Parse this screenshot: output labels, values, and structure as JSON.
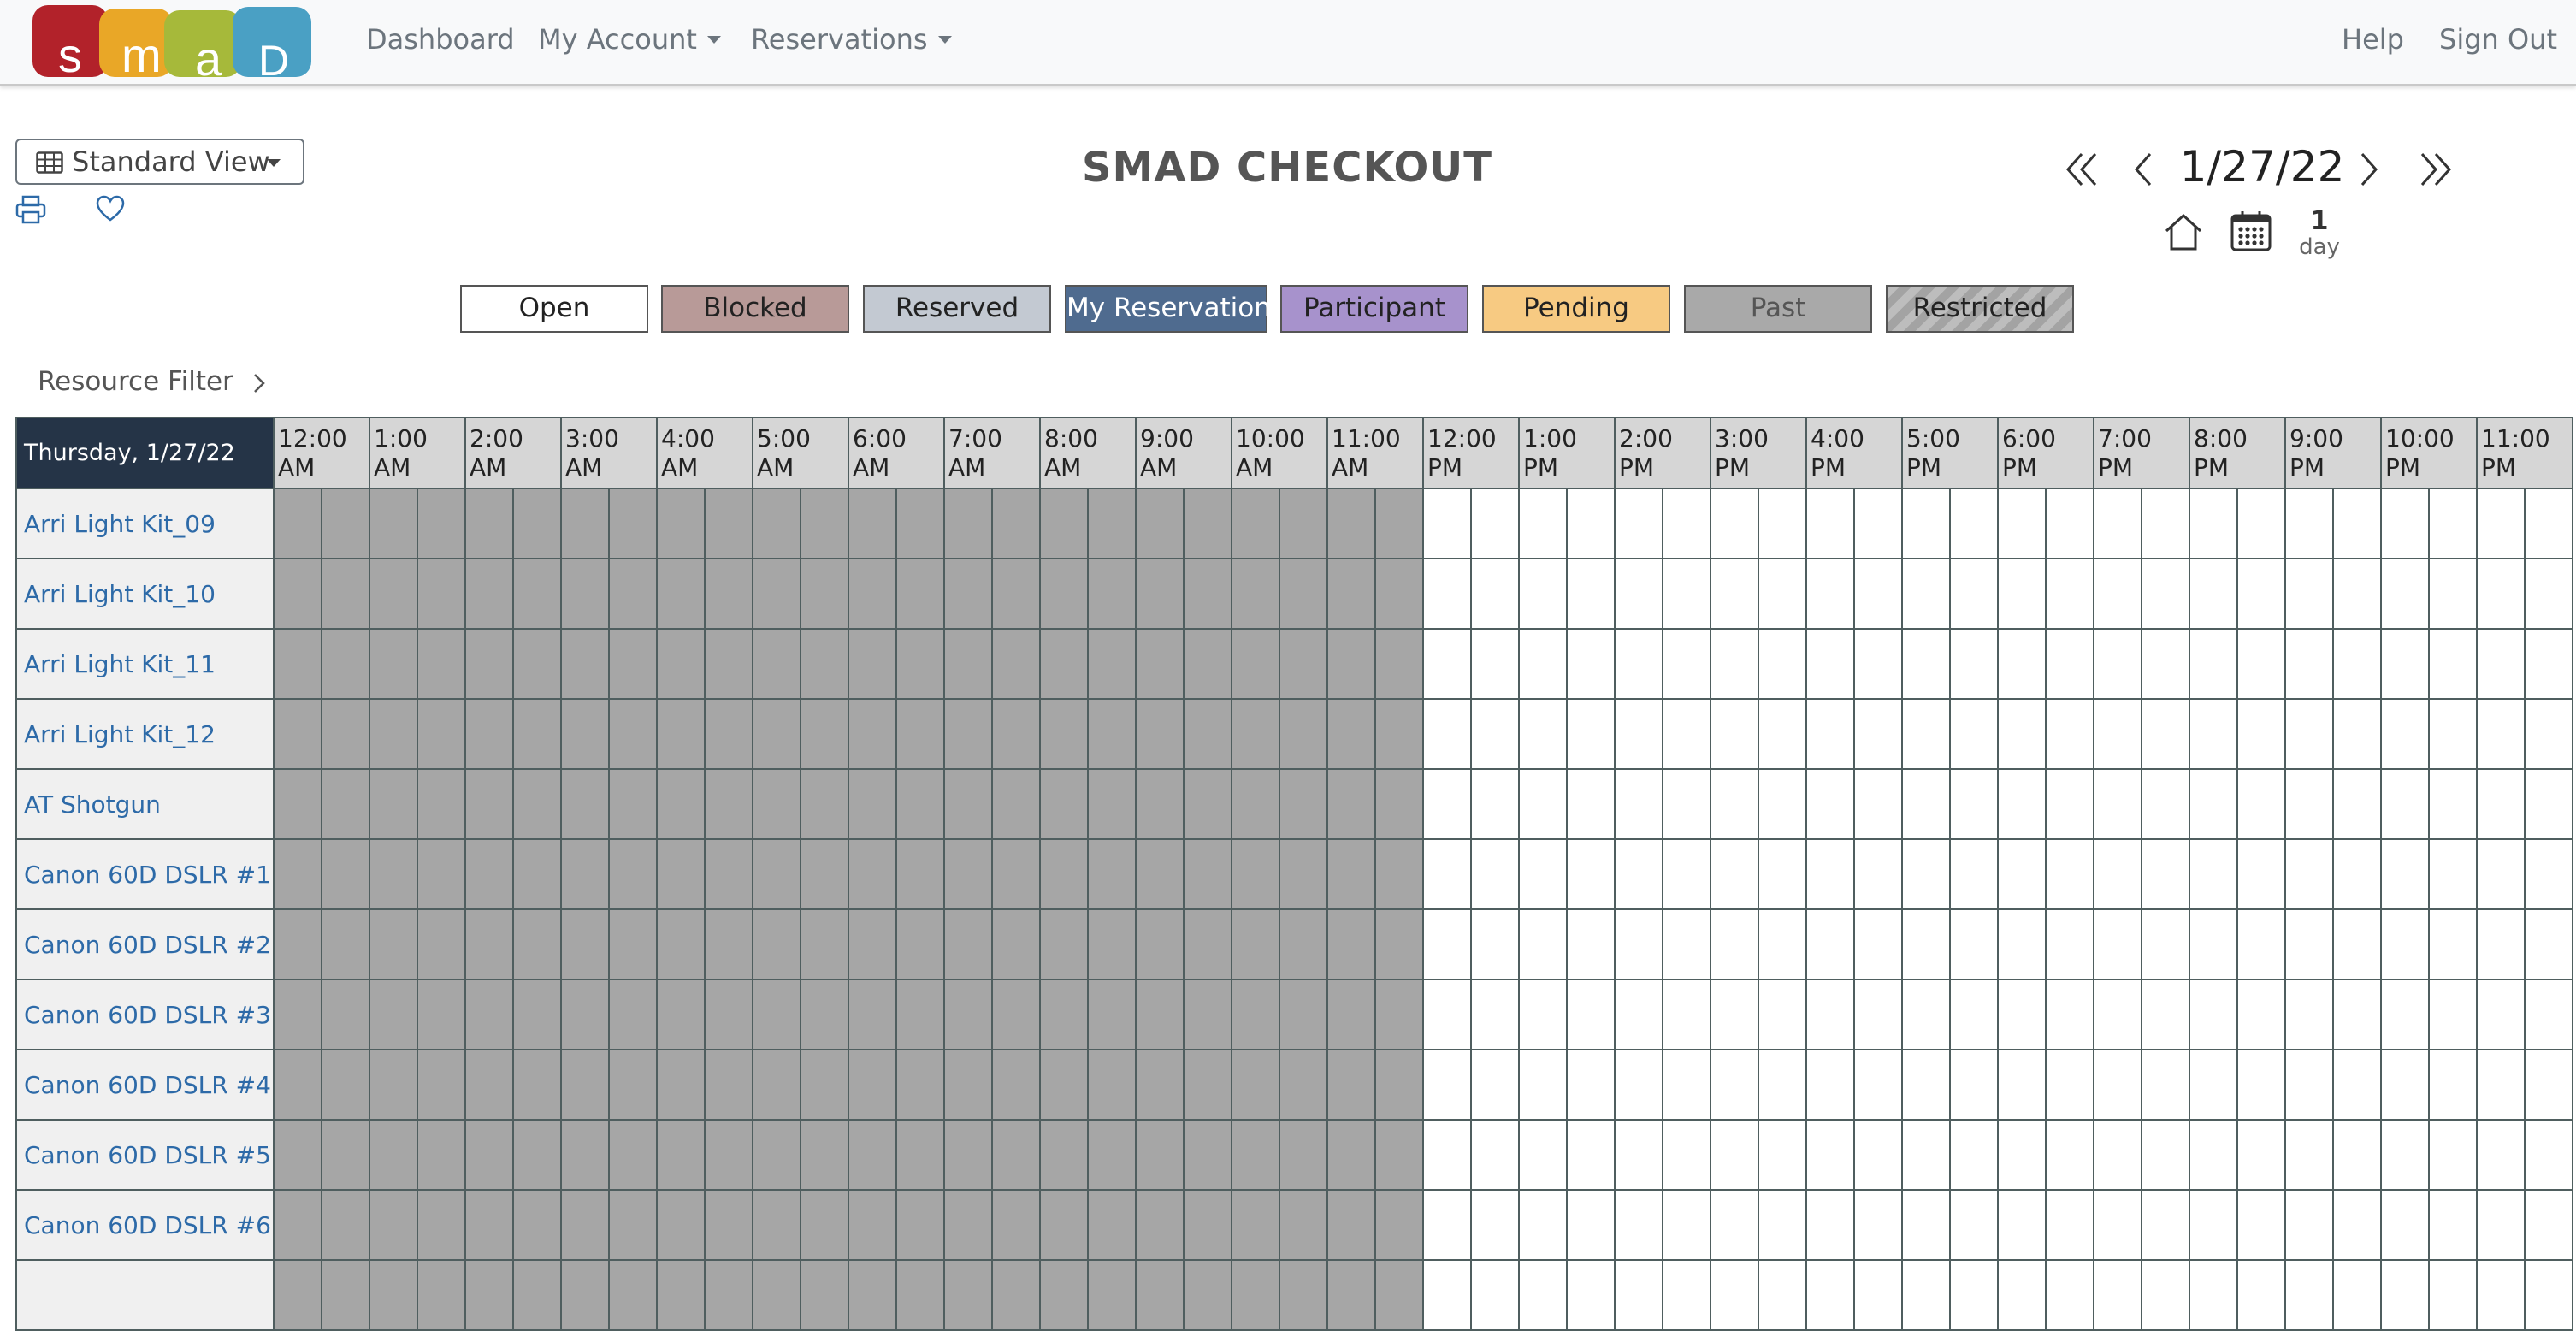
{
  "brand": {
    "logo_letters": [
      "s",
      "m",
      "a",
      "D"
    ]
  },
  "nav": {
    "dashboard": "Dashboard",
    "my_account": "My Account",
    "reservations": "Reservations",
    "help": "Help",
    "sign_out": "Sign Out"
  },
  "toolbar": {
    "view_label": "Standard View",
    "title": "SMAD CHECKOUT",
    "date": "1/27/22",
    "day_count": "1",
    "day_label": "day"
  },
  "legend": [
    {
      "label": "Open",
      "color": "#ffffff",
      "text_color": "#222222"
    },
    {
      "label": "Blocked",
      "color": "#b89a98",
      "text_color": "#222222"
    },
    {
      "label": "Reserved",
      "color": "#c3c9d2",
      "text_color": "#222222"
    },
    {
      "label": "My Reservation",
      "color": "#4f6b8f",
      "text_color": "#ffffff"
    },
    {
      "label": "Participant",
      "color": "#a792cc",
      "text_color": "#222222"
    },
    {
      "label": "Pending",
      "color": "#f7ca82",
      "text_color": "#222222"
    },
    {
      "label": "Past",
      "color": "#a9a9a9",
      "text_color": "#555555"
    },
    {
      "label": "Restricted",
      "color": "#b8b8b8",
      "text_color": "#222222"
    }
  ],
  "resource_filter": "Resource Filter",
  "schedule": {
    "day_header": "Thursday, 1/27/22",
    "hours": [
      "12:00 AM",
      "1:00 AM",
      "2:00 AM",
      "3:00 AM",
      "4:00 AM",
      "5:00 AM",
      "6:00 AM",
      "7:00 AM",
      "8:00 AM",
      "9:00 AM",
      "10:00 AM",
      "11:00 AM",
      "12:00 PM",
      "1:00 PM",
      "2:00 PM",
      "3:00 PM",
      "4:00 PM",
      "5:00 PM",
      "6:00 PM",
      "7:00 PM",
      "8:00 PM",
      "9:00 PM",
      "10:00 PM",
      "11:00 PM"
    ],
    "past_half_hour_slots": 24,
    "resources": [
      "Arri Light Kit_09",
      "Arri Light Kit_10",
      "Arri Light Kit_11",
      "Arri Light Kit_12",
      "AT Shotgun",
      "Canon 60D DSLR #1",
      "Canon 60D DSLR #2",
      "Canon 60D DSLR #3",
      "Canon 60D DSLR #4",
      "Canon 60D DSLR #5",
      "Canon 60D DSLR #6",
      ""
    ]
  }
}
